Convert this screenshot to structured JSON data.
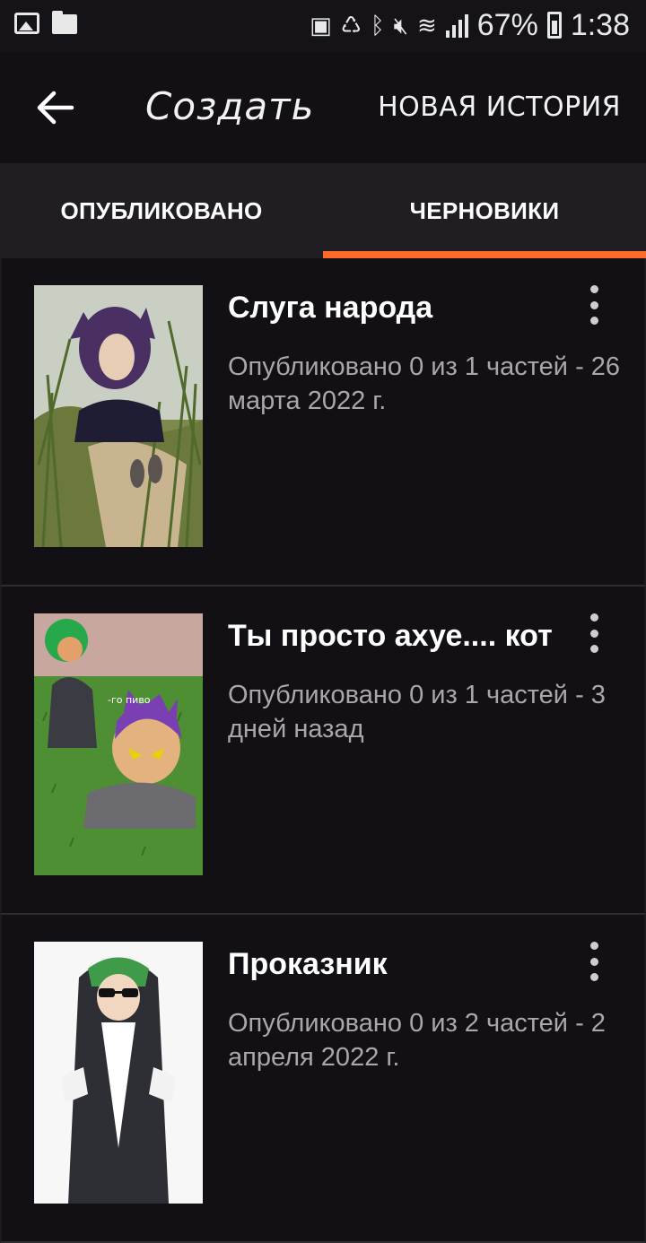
{
  "status_bar": {
    "battery_percent": "67%",
    "time": "1:38",
    "icons": [
      "image-icon",
      "folder-icon",
      "battery-saver-icon",
      "recycle-icon",
      "bluetooth-icon",
      "mute-icon",
      "wifi-icon",
      "signal-icon",
      "battery-icon"
    ]
  },
  "appbar": {
    "back_icon": "arrow-left-icon",
    "title": "Создать",
    "new_story_label": "НОВАЯ ИСТОРИЯ"
  },
  "tabs": [
    {
      "label": "ОПУБЛИКОВАНО",
      "active": false
    },
    {
      "label": "ЧЕРНОВИКИ",
      "active": true
    }
  ],
  "accent_color": "#ff6a2a",
  "stories": [
    {
      "title": "Слуга народа",
      "meta": "Опубликовано 0 из 1 частей - 26 марта 2022 г.",
      "cover_caption": ""
    },
    {
      "title": "Ты просто ахуе.... кот",
      "meta": "Опубликовано 0 из 1 частей - 3 дней назад",
      "cover_caption": "-го пиво"
    },
    {
      "title": "Проказник",
      "meta": "Опубликовано 0 из 2 частей - 2 апреля 2022 г.",
      "cover_caption": ""
    }
  ]
}
